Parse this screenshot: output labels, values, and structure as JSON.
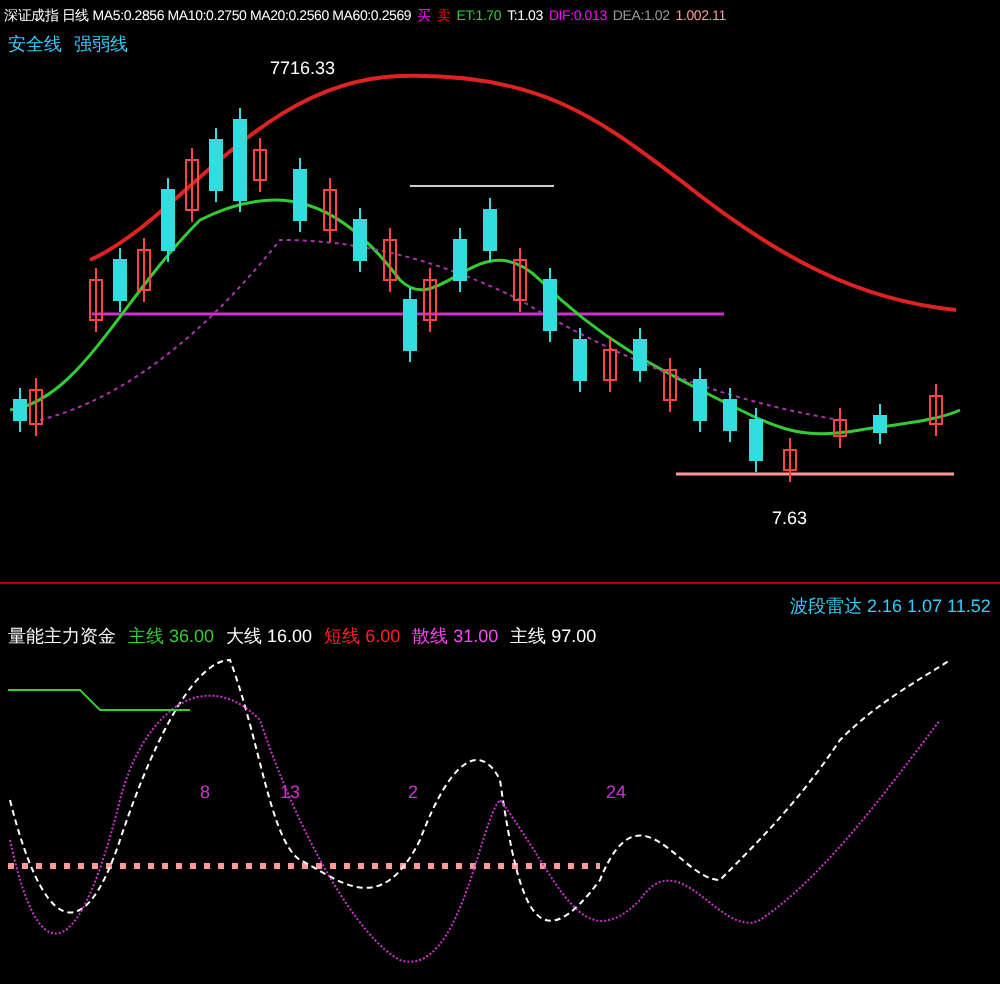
{
  "upper_panel": {
    "header": [
      {
        "text": "深证成指 日线 MA5:0.2856 MA10:0.2750 MA20:0.2560 MA60:0.2569",
        "color": "#ffffff"
      },
      {
        "text": "买",
        "color": "#ff00ff"
      },
      {
        "text": "卖",
        "color": "#ff0000"
      },
      {
        "text": "ET:1.70",
        "color": "#33cc33"
      },
      {
        "text": "T:1.03",
        "color": "#ffffff"
      },
      {
        "text": "DIF:0.013",
        "color": "#ff00ff"
      },
      {
        "text": "DEA:1.02",
        "color": "#999999"
      },
      {
        "text": "1.002.11",
        "color": "#ff9999"
      }
    ],
    "subheader": [
      {
        "text": "安全线",
        "color": "#33ccff"
      },
      {
        "text": "强弱线",
        "color": "#33ccff"
      }
    ],
    "labels": [
      {
        "text": "7716.33",
        "kind": "high"
      },
      {
        "text": "7.63",
        "kind": "low"
      }
    ]
  },
  "lower_panel": {
    "legend": [
      {
        "text": "量能主力资金",
        "color": "#ffffff"
      },
      {
        "text": "主线 36.00",
        "color": "#33cc33"
      },
      {
        "text": "大线 16.00",
        "color": "#ffffff"
      },
      {
        "text": "短线 6.00",
        "color": "#ff2222"
      },
      {
        "text": "散线 31.00",
        "color": "#ff44ff"
      },
      {
        "text": "主线 97.00",
        "color": "#ffffff"
      }
    ],
    "readout": "波段雷达 2.16 1.07 11.52",
    "markers": [
      "8",
      "13",
      "2",
      "24"
    ]
  }
}
